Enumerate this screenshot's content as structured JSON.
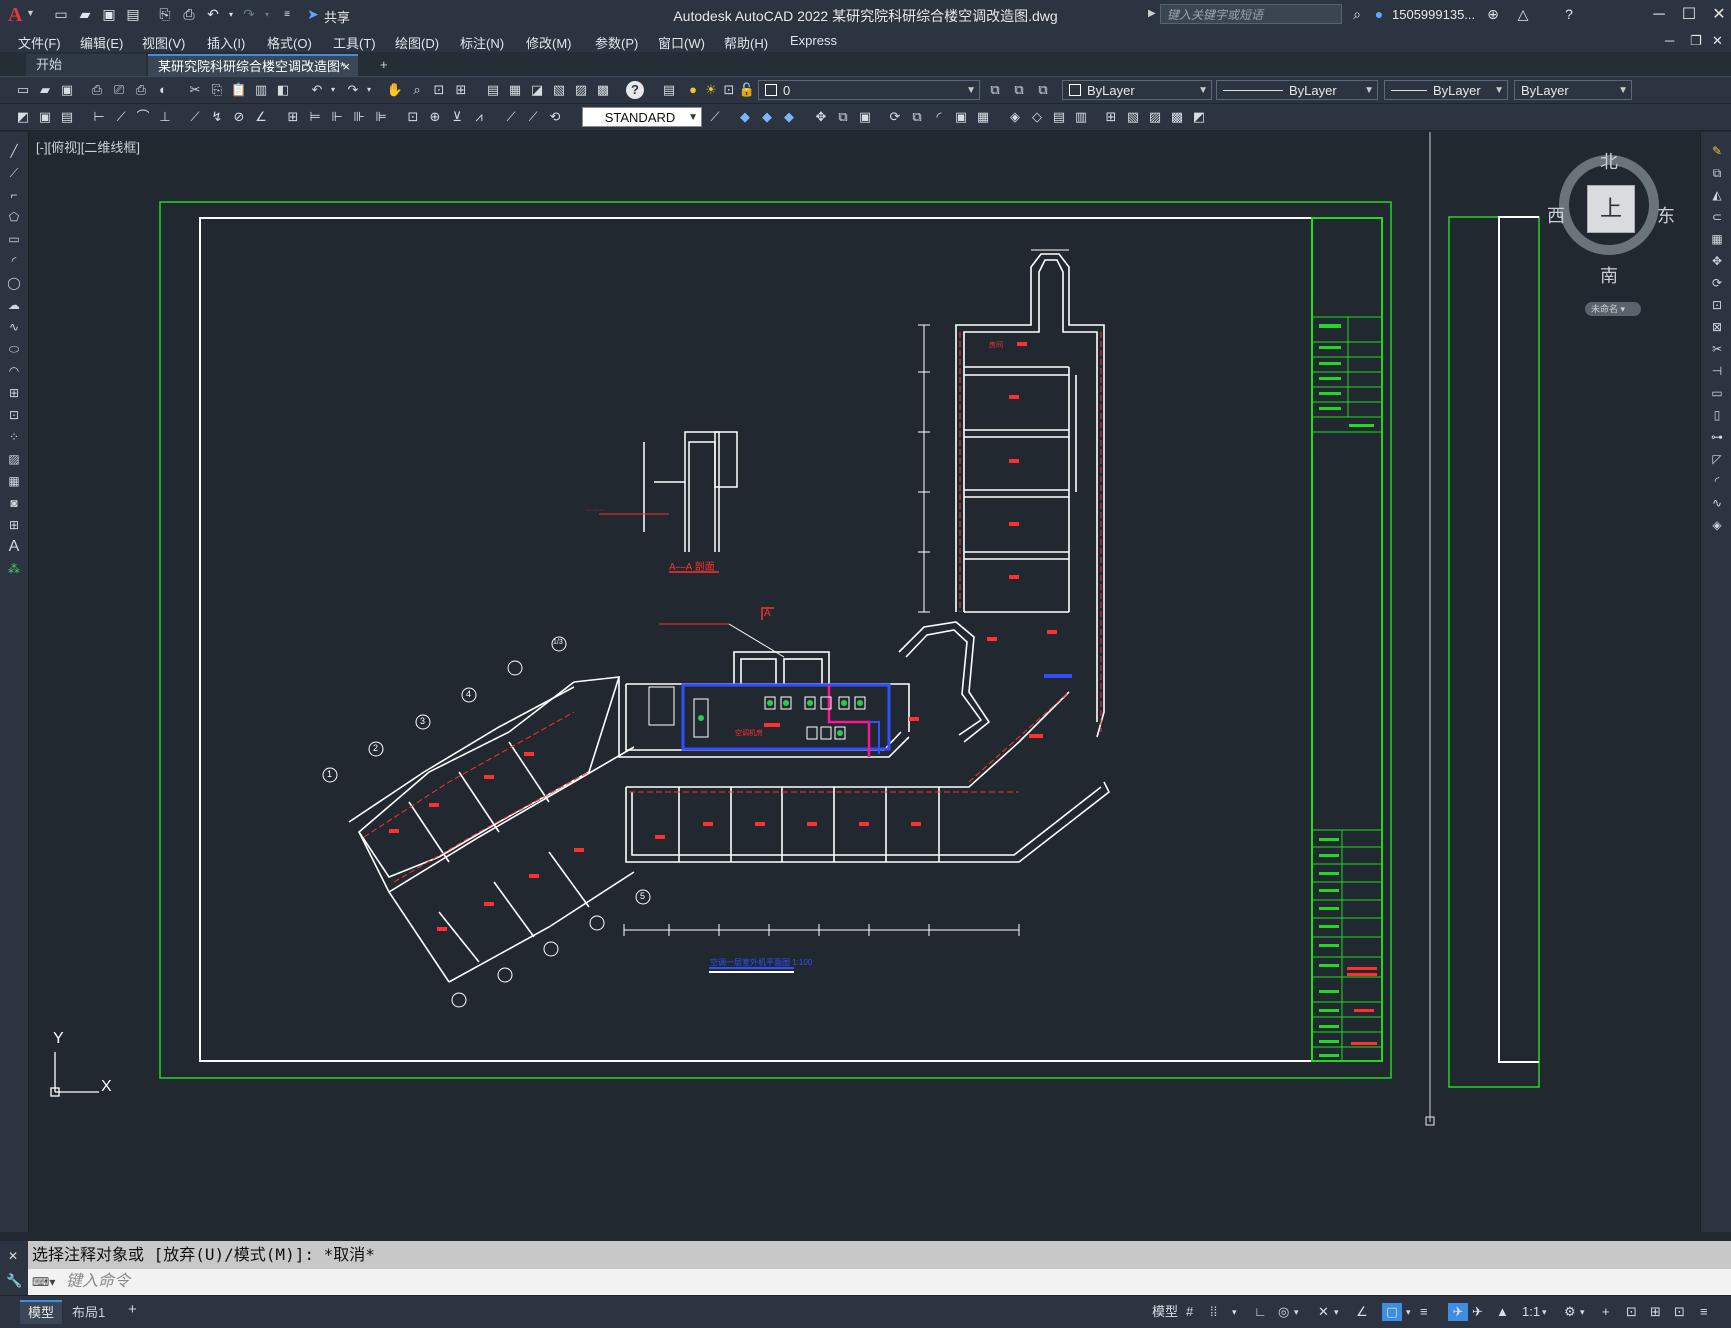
{
  "app": {
    "title": "Autodesk AutoCAD 2022    某研究院科研综合楼空调改造图.dwg",
    "logo": "A",
    "share": "共享",
    "search_placeholder": "键入关键字或短语",
    "user": "1505999135...",
    "help": "?"
  },
  "menu": [
    "文件(F)",
    "编辑(E)",
    "视图(V)",
    "插入(I)",
    "格式(O)",
    "工具(T)",
    "绘图(D)",
    "标注(N)",
    "修改(M)",
    "参数(P)",
    "窗口(W)",
    "帮助(H)",
    "Express"
  ],
  "tabs": {
    "start": "开始",
    "doc": "某研究院科研综合楼空调改造图*",
    "close": "×",
    "add": "+"
  },
  "toolbar": {
    "layer_value": "0",
    "color_value": "ByLayer",
    "linetype_value": "ByLayer",
    "lineweight_value": "ByLayer",
    "plotstyle_value": "ByLayer",
    "textstyle_value": "STANDARD"
  },
  "viewport": {
    "label": "[-][俯视][二维线框]",
    "north": "北",
    "south": "南",
    "east": "东",
    "west": "西",
    "cube_face": "上",
    "wcs": "未命名"
  },
  "drawing": {
    "section_title": "A—A 剖面",
    "section_marker": "A",
    "plan_title": "空调一层室外机平面图 1:100",
    "equipment_label": "空调机房",
    "room_label": "房间",
    "axis_labels": [
      "1",
      "2",
      "3",
      "4",
      "5",
      "1/3"
    ],
    "ucs_x": "X",
    "ucs_y": "Y"
  },
  "command": {
    "history": "选择注释对象或 [放弃(U)/模式(M)]: *取消*",
    "placeholder": "键入命令"
  },
  "status": {
    "layout_tabs": [
      "模型",
      "布局1"
    ],
    "add": "+",
    "model_button": "模型",
    "scale": "1:1"
  }
}
